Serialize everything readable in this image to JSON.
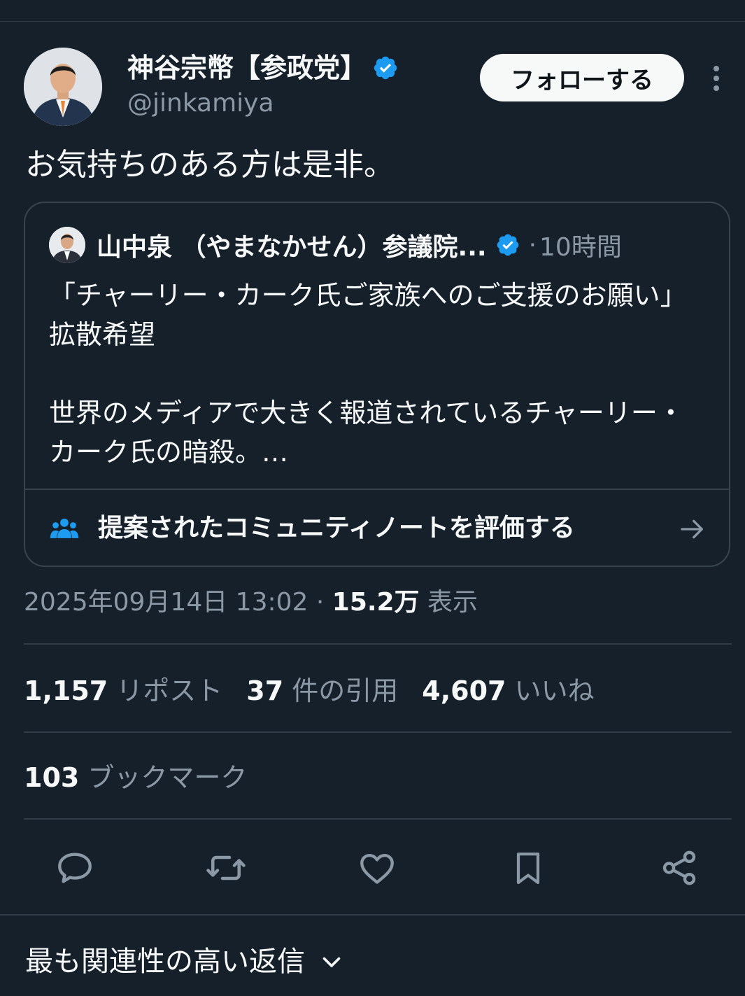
{
  "author": {
    "display_name": "神谷宗幣【参政党】",
    "handle": "@jinkamiya",
    "verified": true
  },
  "follow_button_label": "フォローする",
  "tweet_text": "お気持ちのある方は是非。",
  "quoted": {
    "display_name": "山中泉 （やまなかせん）参議院...",
    "verified": true,
    "separator": "·",
    "time_ago": "10時間",
    "body_line1": "「チャーリー・カーク氏ご家族へのご支援のお願い」拡散希望",
    "body_line2": "世界のメディアで大きく報道されているチャーリー・カーク氏の暗殺。…",
    "community_note_prompt": "提案されたコミュニティノートを評価する"
  },
  "meta": {
    "date": "2025年09月14日 13:02",
    "separator": " · ",
    "views_count": "15.2万",
    "views_label": " 表示"
  },
  "stats": {
    "reposts_count": "1,157",
    "reposts_label": " リポスト",
    "quotes_count": "37",
    "quotes_label": " 件の引用",
    "likes_count": "4,607",
    "likes_label": " いいね",
    "bookmarks_count": "103",
    "bookmarks_label": " ブックマーク"
  },
  "actions": [
    "reply-icon",
    "repost-icon",
    "like-icon",
    "bookmark-icon",
    "share-icon"
  ],
  "replies_sort_label": "最も関連性の高い返信",
  "colors": {
    "background": "#15202b",
    "text": "#f7f9f9",
    "secondary": "#8b98a5",
    "border": "#38444d",
    "verified_blue": "#1d9bf0"
  }
}
